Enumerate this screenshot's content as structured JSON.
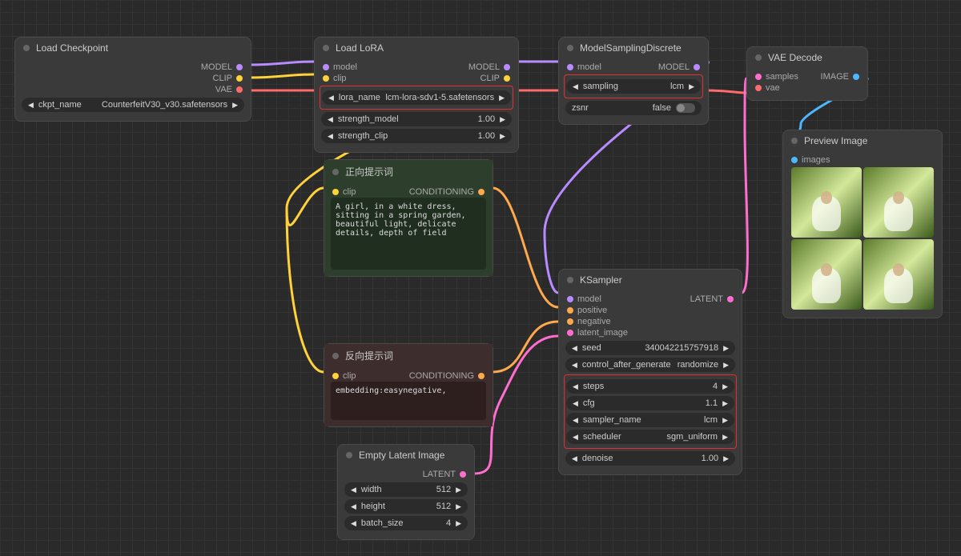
{
  "loadCheckpoint": {
    "title": "Load Checkpoint",
    "out_model": "MODEL",
    "out_clip": "CLIP",
    "out_vae": "VAE",
    "ckpt_name_label": "ckpt_name",
    "ckpt_name_value": "CounterfeitV30_v30.safetensors"
  },
  "loadLora": {
    "title": "Load LoRA",
    "in_model": "model",
    "in_clip": "clip",
    "out_model": "MODEL",
    "out_clip": "CLIP",
    "lora_name_label": "lora_name",
    "lora_name_value": "lcm-lora-sdv1-5.safetensors",
    "strength_model_label": "strength_model",
    "strength_model_value": "1.00",
    "strength_clip_label": "strength_clip",
    "strength_clip_value": "1.00"
  },
  "modelSampling": {
    "title": "ModelSamplingDiscrete",
    "in_model": "model",
    "out_model": "MODEL",
    "sampling_label": "sampling",
    "sampling_value": "lcm",
    "zsnr_label": "zsnr",
    "zsnr_value": "false"
  },
  "vaeDecode": {
    "title": "VAE Decode",
    "in_samples": "samples",
    "in_vae": "vae",
    "out_image": "IMAGE"
  },
  "positive": {
    "title": "正向提示词",
    "in_clip": "clip",
    "out": "CONDITIONING",
    "text": "A girl, in a white dress, sitting in a spring garden, beautiful light, delicate details, depth of field"
  },
  "negative": {
    "title": "反向提示词",
    "in_clip": "clip",
    "out": "CONDITIONING",
    "text": "embedding:easynegative,"
  },
  "emptyLatent": {
    "title": "Empty Latent Image",
    "out": "LATENT",
    "width_label": "width",
    "width_value": "512",
    "height_label": "height",
    "height_value": "512",
    "batch_label": "batch_size",
    "batch_value": "4"
  },
  "ksampler": {
    "title": "KSampler",
    "in_model": "model",
    "in_positive": "positive",
    "in_negative": "negative",
    "in_latent": "latent_image",
    "out": "LATENT",
    "seed_label": "seed",
    "seed_value": "340042215757918",
    "control_label": "control_after_generate",
    "control_value": "randomize",
    "steps_label": "steps",
    "steps_value": "4",
    "cfg_label": "cfg",
    "cfg_value": "1.1",
    "sampler_label": "sampler_name",
    "sampler_value": "lcm",
    "scheduler_label": "scheduler",
    "scheduler_value": "sgm_uniform",
    "denoise_label": "denoise",
    "denoise_value": "1.00"
  },
  "preview": {
    "title": "Preview Image",
    "in_images": "images"
  }
}
